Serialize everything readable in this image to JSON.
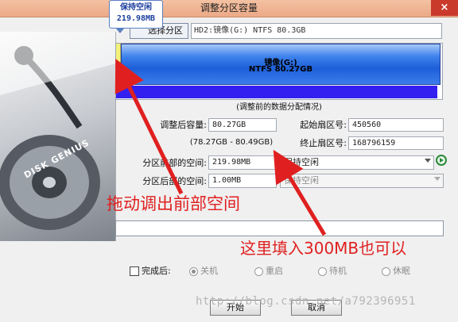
{
  "window": {
    "title": "调整分区容量",
    "close_icon": "close-icon"
  },
  "partition": {
    "select_button": "选择分区",
    "label": "HD2:镜像(G:) NTFS 80.3GB",
    "bar_name": "镜像(G:)",
    "bar_size": "NTFS 80.27GB",
    "caption": "(调整前的数据分配情况)"
  },
  "form": {
    "new_size_label": "调整后容量:",
    "new_size_value": "80.27GB",
    "range": "(78.27GB - 80.49GB)",
    "start_sector_label": "起始扇区号:",
    "start_sector_value": "450560",
    "end_sector_label": "终止扇区号:",
    "end_sector_value": "168796159",
    "front_space_label": "分区前部的空间:",
    "front_space_value": "219.98MB",
    "front_action": "保持空闲",
    "back_space_label": "分区后部的空间:",
    "back_space_value": "1.00MB",
    "back_action": "保持空闲"
  },
  "progress": {
    "fraction": 0
  },
  "after_completion": {
    "checkbox_label": "完成后:",
    "options": [
      "关机",
      "重启",
      "待机",
      "休眠"
    ],
    "selected": "关机"
  },
  "buttons": {
    "start": "开始",
    "cancel": "取消"
  },
  "tooltip": {
    "title": "保持空闲",
    "value": "219.98MB"
  },
  "annotations": {
    "drag_hint": "拖动调出前部空间",
    "input_hint": "这里填入300MB也可以"
  },
  "watermark": "http://blog.csdn.net/a792396951",
  "colors": {
    "annotation": "#e02020",
    "partition_fill": "#3f83ee",
    "free_space": "#f4f17a"
  },
  "disk_panel": {
    "brand": "DISK GENIUS"
  }
}
